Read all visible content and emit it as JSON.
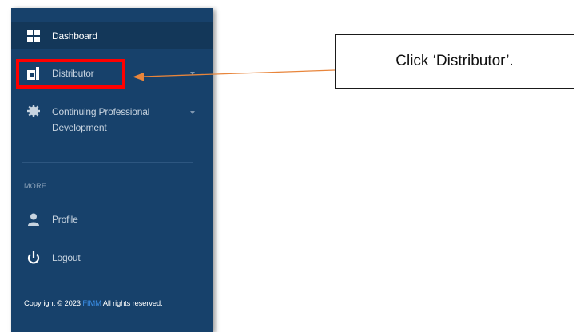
{
  "sidebar": {
    "items": [
      {
        "label": "Dashboard",
        "icon": "dashboard-grid-icon",
        "active": true
      },
      {
        "label": "Distributor",
        "icon": "distributor-d-icon",
        "has_submenu": true
      },
      {
        "label": "Continuing Professional Development",
        "label_line1": "Continuing Professional",
        "label_line2": "Development",
        "icon": "gear-icon",
        "has_submenu": true
      }
    ],
    "section_header": "MORE",
    "more_items": [
      {
        "label": "Profile",
        "icon": "user-icon"
      },
      {
        "label": "Logout",
        "icon": "power-icon"
      }
    ],
    "footer": {
      "prefix": "Copyright © 2023 ",
      "brand": "FIMM",
      "suffix": " All rights reserved."
    }
  },
  "annotation": {
    "callout_text": "Click ‘Distributor’.",
    "highlight_color": "#ff0000",
    "arrow_color": "#e8853b"
  },
  "colors": {
    "sidebar_bg": "#17416b",
    "active_bg": "#133759",
    "brand_link": "#3a8ee6"
  }
}
